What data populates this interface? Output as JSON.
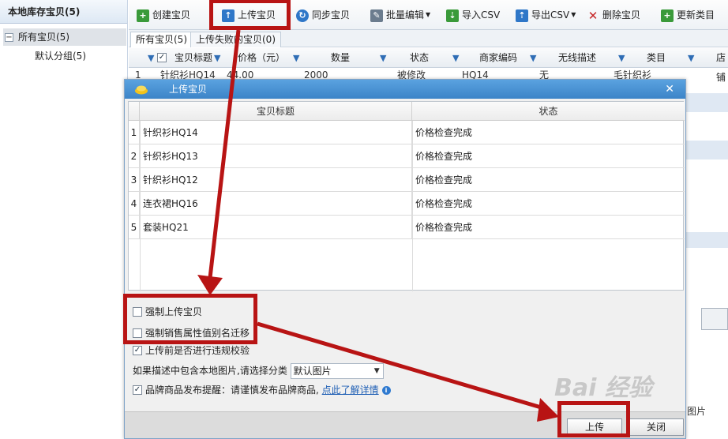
{
  "left_panel": {
    "title": "本地库存宝贝(5)",
    "tree": {
      "root": "所有宝贝(5)",
      "child": "默认分组(5)"
    }
  },
  "toolbar": {
    "create": "创建宝贝",
    "upload": "上传宝贝",
    "sync": "同步宝贝",
    "batch_edit": "批量编辑",
    "import_csv": "导入CSV",
    "export_csv": "导出CSV",
    "delete": "删除宝贝",
    "update_category": "更新类目"
  },
  "tabs": [
    "所有宝贝(5)",
    "上传失败的宝贝(0)"
  ],
  "grid": {
    "columns": [
      "宝贝标题",
      "价格（元）",
      "数量",
      "状态",
      "商家编码",
      "无线描述",
      "类目",
      "店铺"
    ],
    "first_row": {
      "num": "1",
      "title": "针织衫HQ14",
      "price": "44.00",
      "qty": "2000",
      "status": "被修改",
      "code": "HQ14",
      "mobile": "无",
      "category": "毛针织衫"
    }
  },
  "modal": {
    "title": "上传宝贝",
    "columns": [
      "宝贝标题",
      "状态"
    ],
    "rows": [
      {
        "num": "1",
        "title": "针织衫HQ14",
        "status": "价格检查完成"
      },
      {
        "num": "2",
        "title": "针织衫HQ13",
        "status": "价格检查完成"
      },
      {
        "num": "3",
        "title": "针织衫HQ12",
        "status": "价格检查完成"
      },
      {
        "num": "4",
        "title": "连衣裙HQ16",
        "status": "价格检查完成"
      },
      {
        "num": "5",
        "title": "套装HQ21",
        "status": "价格检查完成"
      }
    ],
    "options": {
      "force_upload": "强制上传宝贝",
      "force_migrate": "强制销售属性值别名迁移",
      "check_violation": "上传前是否进行违规校验",
      "image_category_label": "如果描述中包含本地图片,请选择分类",
      "image_category_value": "默认图片",
      "brand_notice": "品牌商品发布提醒：请谨慎发布品牌商品,",
      "brand_link": "点此了解详情"
    },
    "buttons": {
      "upload": "上传",
      "close": "关闭"
    }
  },
  "background": {
    "bottom_text": "图片"
  },
  "watermark": "Bai 经验",
  "colors": {
    "accent": "#3c84c8",
    "annotation": "#b81414"
  }
}
